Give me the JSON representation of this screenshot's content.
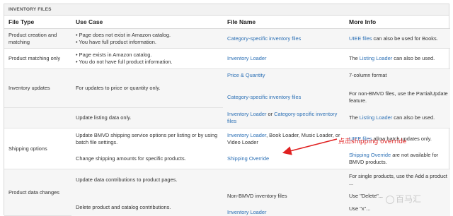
{
  "panel": {
    "title": "INVENTORY FILES"
  },
  "headers": {
    "file_type": "File Type",
    "use_case": "Use Case",
    "file_name": "File Name",
    "more_info": "More Info"
  },
  "rows": {
    "r1": {
      "type": "Product creation and matching",
      "use": [
        "Page does not exist in Amazon catalog.",
        "You have full product information."
      ],
      "file_link": "Category-specific inventory files",
      "info_link": "UIEE files",
      "info_rest": " can also be used for Books."
    },
    "r2": {
      "type": "Product matching only",
      "use": [
        "Page exists in Amazon catalog.",
        "You do not have full product information."
      ],
      "file_link": "Inventory Loader",
      "info_pre": "The ",
      "info_link": "Listing Loader",
      "info_rest": " can also be used."
    },
    "r3": {
      "type": "Inventory updates",
      "use": "For updates to price or quantity only.",
      "s1_link": "Price & Quantity",
      "s1_info": "7-column format",
      "s2_link": "Category-specific inventory files",
      "s2_info": "For non-BMVD files, use the PartialUpdate feature.",
      "s3_use": "Update listing data only.",
      "s3_link1": "Inventory Loader",
      "s3_or": " or ",
      "s3_link2": "Category-specific inventory files",
      "s3_info_pre": "The ",
      "s3_info_link": "Listing Loader",
      "s3_info_rest": " can also be used."
    },
    "r4": {
      "type": "Shipping options",
      "s1_use": "Update BMVD shipping service options per listing or by using batch file settings.",
      "s1_link": "Inventory Loader",
      "s1_rest": ", Book Loader, Music Loader, or Video Loader",
      "s1_info_link": "UIEE files",
      "s1_info_rest": " allow batch updates only.",
      "s2_use": "Change shipping amounts for specific products.",
      "s2_link": "Shipping Override",
      "s2_info_link": "Shipping Override",
      "s2_info_rest": " are not available for BMVD products."
    },
    "r5": {
      "type": "Product data changes",
      "s1_use": "Update data contributions to product pages.",
      "s1_info": "For single products, use the Add a product ...",
      "s2_file": "Non-BMVD inventory files",
      "s2_info": "Use \"Delete\"...",
      "s3_use": "Delete product and catalog contributions.",
      "s3_link": "Inventory Loader",
      "s3_info": "Use \"x\"..."
    }
  },
  "annotation": {
    "text": "点击shipping override",
    "color": "#e02020"
  },
  "watermark": {
    "text": "百马汇"
  }
}
